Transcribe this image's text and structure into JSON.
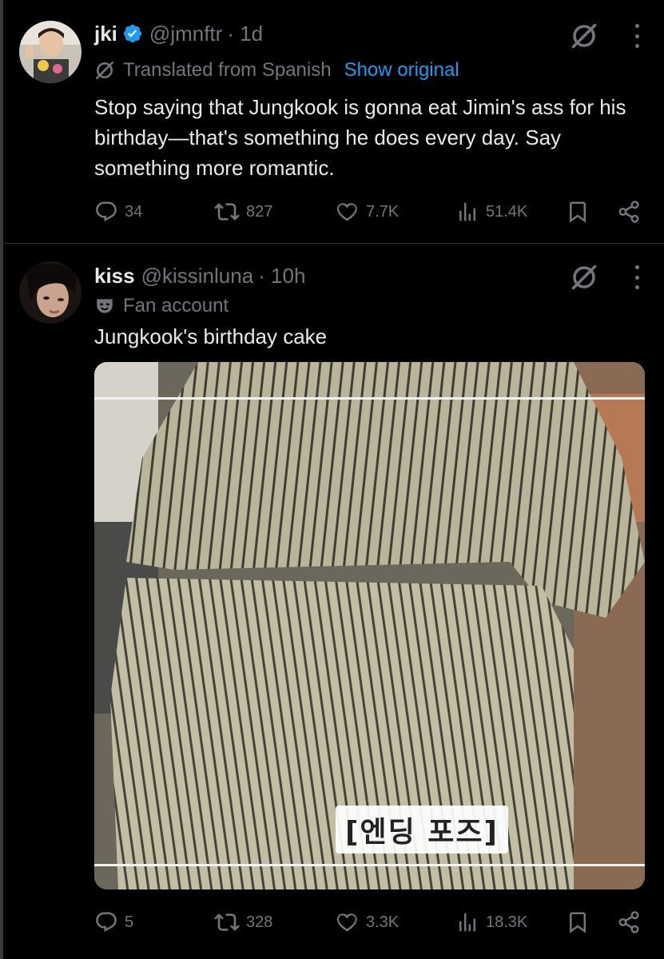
{
  "tweets": [
    {
      "display_name": "jki",
      "handle": "@jmnftr",
      "time": "· 1d",
      "translation_note": "Translated from Spanish",
      "show_original": "Show original",
      "text": "Stop saying that Jungkook is gonna eat Jimin's ass for his birthday—that's something he does every day. Say something more romantic.",
      "replies": "34",
      "reposts": "827",
      "likes": "7.7K",
      "views": "51.4K",
      "icons": [
        "verified-badge-icon",
        "grok-icon",
        "more-icon",
        "translate-icon",
        "reply-icon",
        "repost-icon",
        "like-icon",
        "views-icon",
        "bookmark-icon",
        "share-icon"
      ]
    },
    {
      "display_name": "kiss",
      "handle": "@kissinluna",
      "time": "· 10h",
      "label": "Fan account",
      "text": "Jungkook's birthday cake",
      "media_caption": "[엔딩 포즈]",
      "replies": "5",
      "reposts": "328",
      "likes": "3.3K",
      "views": "18.3K",
      "icons": [
        "grok-icon",
        "more-icon",
        "fan-account-mask-icon",
        "reply-icon",
        "repost-icon",
        "like-icon",
        "views-icon",
        "bookmark-icon",
        "share-icon"
      ]
    }
  ],
  "colors": {
    "background": "#000000",
    "text": "#e7e9ea",
    "muted": "#71767b",
    "link": "#1d9bf0",
    "verified": "#1d9bf0",
    "divider": "#2f3336"
  }
}
